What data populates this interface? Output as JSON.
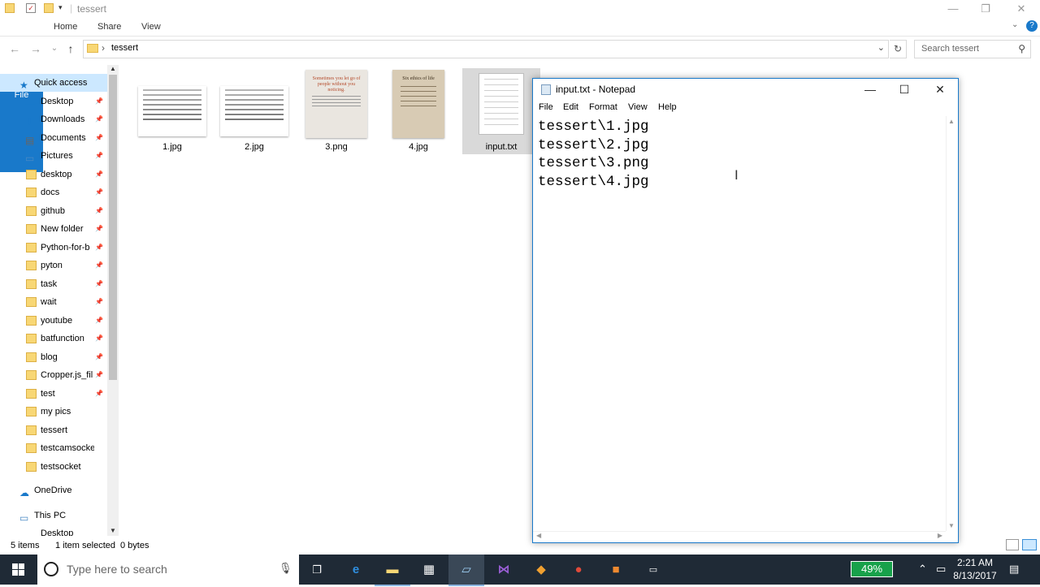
{
  "explorer": {
    "title": "tessert",
    "tabs": [
      "File",
      "Home",
      "Share",
      "View"
    ],
    "address": {
      "path": "tessert",
      "separator": "›"
    },
    "search_placeholder": "Search tessert",
    "nav_items": [
      {
        "label": "Quick access",
        "type": "quick"
      },
      {
        "label": "Desktop",
        "type": "desktop",
        "pinned": true
      },
      {
        "label": "Downloads",
        "type": "downloads",
        "pinned": true
      },
      {
        "label": "Documents",
        "type": "documents",
        "pinned": true
      },
      {
        "label": "Pictures",
        "type": "pictures",
        "pinned": true
      },
      {
        "label": "desktop",
        "type": "folder",
        "pinned": true
      },
      {
        "label": "docs",
        "type": "folder",
        "pinned": true
      },
      {
        "label": "github",
        "type": "folder",
        "pinned": true
      },
      {
        "label": "New folder",
        "type": "folder",
        "pinned": true
      },
      {
        "label": "Python-for-b",
        "type": "folder",
        "pinned": true
      },
      {
        "label": "pyton",
        "type": "folder",
        "pinned": true
      },
      {
        "label": "task",
        "type": "folder",
        "pinned": true
      },
      {
        "label": "wait",
        "type": "folder",
        "pinned": true
      },
      {
        "label": "youtube",
        "type": "folder",
        "pinned": true
      },
      {
        "label": "batfunction",
        "type": "folder",
        "pinned": true
      },
      {
        "label": "blog",
        "type": "folder",
        "pinned": true
      },
      {
        "label": "Cropper.js_fil",
        "type": "folder",
        "pinned": true
      },
      {
        "label": "test",
        "type": "folder",
        "pinned": true
      },
      {
        "label": "my pics",
        "type": "folder",
        "pinned": false
      },
      {
        "label": "tessert",
        "type": "folder",
        "pinned": false
      },
      {
        "label": "testcamsockets",
        "type": "folder",
        "pinned": false
      },
      {
        "label": "testsocket",
        "type": "folder",
        "pinned": false
      },
      {
        "label": "OneDrive",
        "type": "onedrive"
      },
      {
        "label": "This PC",
        "type": "pc"
      },
      {
        "label": "Desktop",
        "type": "desktop"
      }
    ],
    "files": [
      {
        "name": "1.jpg",
        "kind": "doc-image"
      },
      {
        "name": "2.jpg",
        "kind": "doc-image"
      },
      {
        "name": "3.png",
        "kind": "quote-image",
        "caption": "Sometimes you let go of people without you noticing."
      },
      {
        "name": "4.jpg",
        "kind": "poster-image",
        "caption": "Six ethics of life"
      },
      {
        "name": "input.txt",
        "kind": "text-file",
        "selected": true
      }
    ],
    "status": {
      "items": "5 items",
      "selected": "1 item selected",
      "size": "0 bytes"
    }
  },
  "notepad": {
    "title": "input.txt - Notepad",
    "menu": [
      "File",
      "Edit",
      "Format",
      "View",
      "Help"
    ],
    "lines": [
      "tessert\\1.jpg",
      "tessert\\2.jpg",
      "tessert\\3.png",
      "tessert\\4.jpg"
    ]
  },
  "taskbar": {
    "search_placeholder": "Type here to search",
    "battery": "49%",
    "time": "2:21 AM",
    "date": "8/13/2017"
  }
}
